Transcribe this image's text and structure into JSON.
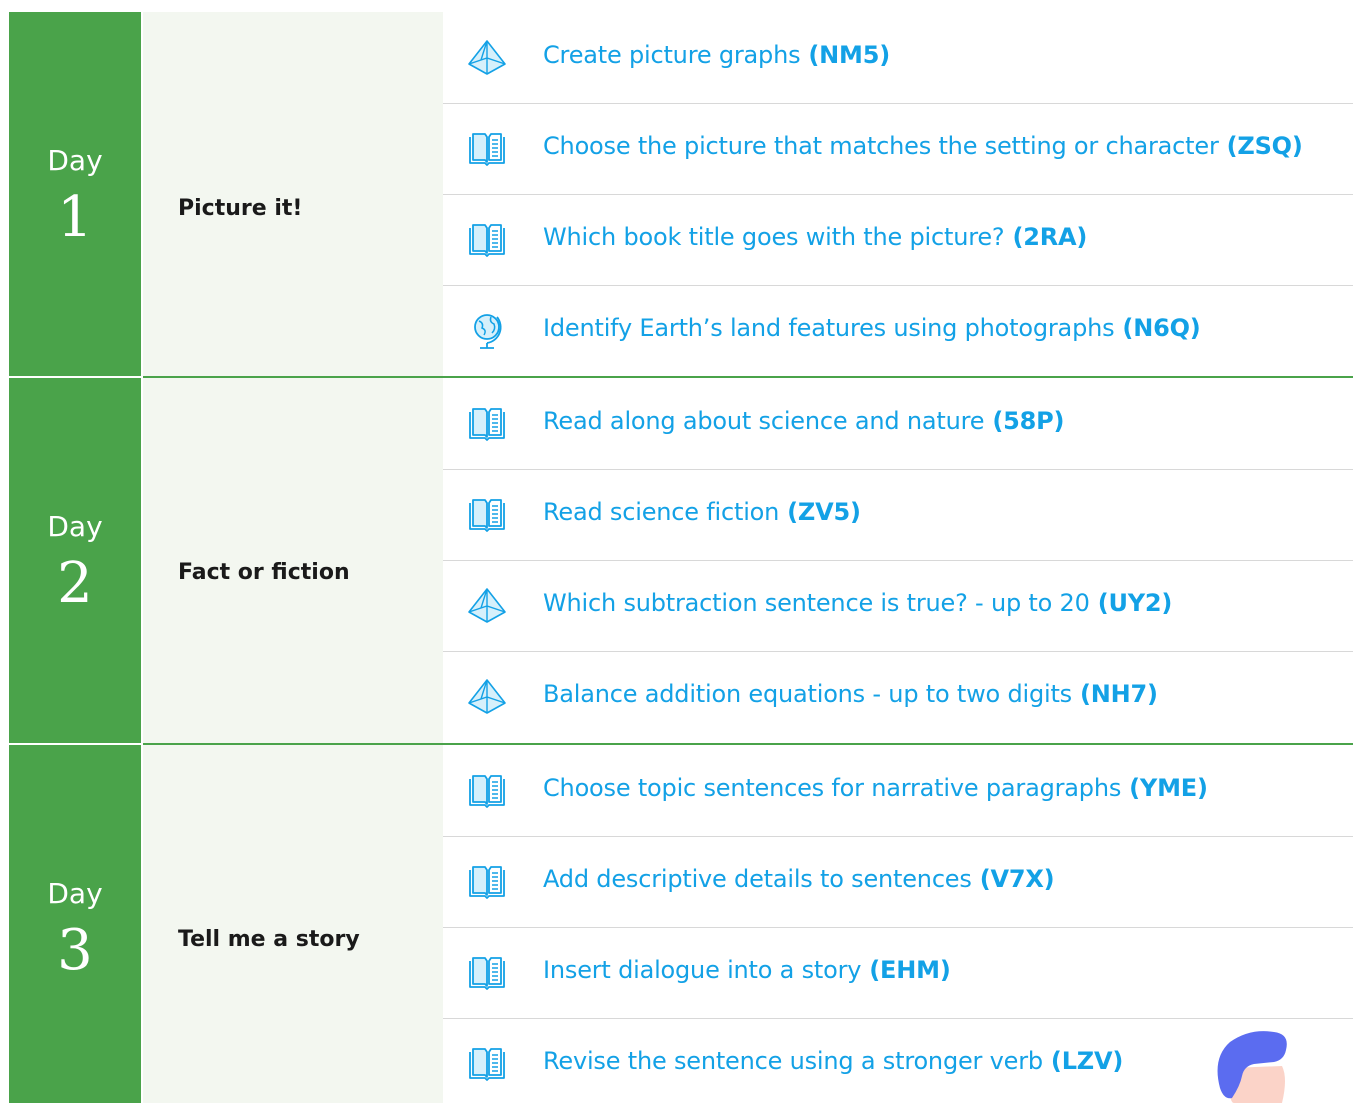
{
  "days": [
    {
      "day_word": "Day",
      "day_number": "1",
      "theme": "Picture it!",
      "skills": [
        {
          "icon": "math-pyramid-icon",
          "title": "Create picture graphs",
          "code": "(NM5)"
        },
        {
          "icon": "book-icon",
          "title": "Choose the picture that matches the setting or character",
          "code": "(ZSQ)"
        },
        {
          "icon": "book-icon",
          "title": "Which book title goes with the picture?",
          "code": "(2RA)"
        },
        {
          "icon": "globe-icon",
          "title": "Identify Earth’s land features using photographs",
          "code": "(N6Q)"
        }
      ]
    },
    {
      "day_word": "Day",
      "day_number": "2",
      "theme": "Fact or fiction",
      "skills": [
        {
          "icon": "book-icon",
          "title": "Read along about science and nature",
          "code": "(58P)"
        },
        {
          "icon": "book-icon",
          "title": "Read science fiction",
          "code": "(ZV5)"
        },
        {
          "icon": "math-pyramid-icon",
          "title": "Which subtraction sentence is true? - up to 20",
          "code": "(UY2)"
        },
        {
          "icon": "math-pyramid-icon",
          "title": "Balance addition equations - up to two digits",
          "code": "(NH7)"
        }
      ]
    },
    {
      "day_word": "Day",
      "day_number": "3",
      "theme": "Tell me a story",
      "skills": [
        {
          "icon": "book-icon",
          "title": "Choose topic sentences for narrative paragraphs",
          "code": "(YME)"
        },
        {
          "icon": "book-icon",
          "title": "Add descriptive details to sentences",
          "code": "(V7X)"
        },
        {
          "icon": "book-icon",
          "title": "Insert dialogue into a story",
          "code": "(EHM)"
        },
        {
          "icon": "book-icon",
          "title": "Revise the sentence using a stronger verb",
          "code": "(LZV)"
        }
      ]
    }
  ],
  "colors": {
    "day_green": "#4aa34a",
    "theme_bg": "#f3f7f0",
    "link_blue": "#13a1e6",
    "divider": "#d8d8d8",
    "mascot_hair": "#5b6cf0",
    "mascot_skin": "#fbd3c8"
  }
}
